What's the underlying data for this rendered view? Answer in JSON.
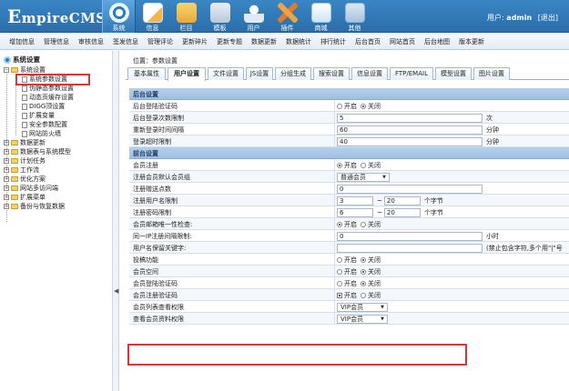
{
  "header": {
    "logo_e": "E",
    "logo_rest": "mpireCMS",
    "nav": [
      {
        "label": "系统",
        "icon": "system-icon",
        "active": true
      },
      {
        "label": "信息",
        "icon": "info-icon"
      },
      {
        "label": "栏目",
        "icon": "column-icon"
      },
      {
        "label": "模板",
        "icon": "template-icon"
      },
      {
        "label": "用户",
        "icon": "user-icon"
      },
      {
        "label": "插件",
        "icon": "plugin-icon"
      },
      {
        "label": "商城",
        "icon": "shop-icon"
      },
      {
        "label": "其他",
        "icon": "other-icon"
      }
    ],
    "user_prefix": "用户:",
    "username": "admin",
    "logout": "[退出]"
  },
  "submenu": [
    "增加信息",
    "管理信息",
    "审核信息",
    "签发信息",
    "管理评论",
    "更新碎片",
    "更新专题",
    "数据更新",
    "数据统计",
    "排行统计",
    "后台首页",
    "网站首页",
    "后台地图",
    "版本更新"
  ],
  "tree": {
    "root": "系统设置",
    "items": [
      {
        "label": "系统设置",
        "level": 0,
        "type": "folder",
        "expanded": true
      },
      {
        "label": "系统参数设置",
        "level": 1,
        "type": "doc"
      },
      {
        "label": "伪静态参数设置",
        "level": 1,
        "type": "doc"
      },
      {
        "label": "动态页缓存设置",
        "level": 1,
        "type": "doc"
      },
      {
        "label": "DIGG顶设置",
        "level": 1,
        "type": "doc"
      },
      {
        "label": "扩展变量",
        "level": 1,
        "type": "doc"
      },
      {
        "label": "安全参数配置",
        "level": 1,
        "type": "doc"
      },
      {
        "label": "网站防火墙",
        "level": 1,
        "type": "doc"
      },
      {
        "label": "数据更新",
        "level": 0,
        "type": "folder"
      },
      {
        "label": "数据表与系统模型",
        "level": 0,
        "type": "folder"
      },
      {
        "label": "计划任务",
        "level": 0,
        "type": "folder"
      },
      {
        "label": "工作流",
        "level": 0,
        "type": "folder"
      },
      {
        "label": "优化方案",
        "level": 0,
        "type": "folder"
      },
      {
        "label": "网站多访问端",
        "level": 0,
        "type": "folder"
      },
      {
        "label": "扩展菜单",
        "level": 0,
        "type": "folder"
      },
      {
        "label": "备份与恢复数据",
        "level": 0,
        "type": "folder"
      }
    ]
  },
  "collapse_arrow": "◀",
  "breadcrumb": "位置：参数设置",
  "tabs": [
    "基本属性",
    "用户设置",
    "文件设置",
    "JS设置",
    "分组生成",
    "搜索设置",
    "信息设置",
    "FTP/EMAIL",
    "模型设置",
    "图片设置"
  ],
  "active_tab": "用户设置",
  "options": {
    "on": "开启",
    "off": "关闭"
  },
  "rows": [
    {
      "type": "section",
      "label": "后台设置"
    },
    {
      "type": "radio",
      "label": "后台登陆验证码",
      "value": "off"
    },
    {
      "type": "input",
      "label": "后台登录次数限制",
      "value": "5",
      "unit": "次",
      "width": 130
    },
    {
      "type": "input",
      "label": "重新登录时间间隔",
      "value": "60",
      "unit": "分钟",
      "width": 160
    },
    {
      "type": "input",
      "label": "登录超时限制",
      "value": "40",
      "unit": "分钟",
      "width": 160
    },
    {
      "type": "section",
      "label": "前台设置"
    },
    {
      "type": "radio",
      "label": "会员注册",
      "value": "on"
    },
    {
      "type": "select",
      "label": "注册会员默认会员组",
      "value": "普通会员"
    },
    {
      "type": "input",
      "label": "注册赠送点数",
      "value": "0",
      "width": 160
    },
    {
      "type": "range",
      "label": "注册用户名限制",
      "min": "3",
      "max": "20",
      "unit": "个字节"
    },
    {
      "type": "range",
      "label": "注册密码限制",
      "min": "6",
      "max": "20",
      "unit": "个字节"
    },
    {
      "type": "radio",
      "label": "会员邮箱唯一性检查:",
      "value": "on"
    },
    {
      "type": "input",
      "label": "同一IP注册间隔限制:",
      "value": "0",
      "unit": "小时",
      "width": 160
    },
    {
      "type": "input",
      "label": "用户名保留关键字:",
      "value": "",
      "unit": "(禁止包含字符,多个用\"|\"号",
      "width": 160
    },
    {
      "type": "radio",
      "label": "投稿功能",
      "value": "off"
    },
    {
      "type": "radio",
      "label": "会员空间",
      "value": "off"
    },
    {
      "type": "radio",
      "label": "会员登陆验证码",
      "value": "off"
    },
    {
      "type": "checkradio",
      "label": "会员注册验证码",
      "value": "on"
    },
    {
      "type": "select",
      "label": "会员列表查看权限",
      "value": "VIP会员"
    },
    {
      "type": "select",
      "label": "查看会员资料权限",
      "value": "VIP会员"
    }
  ]
}
